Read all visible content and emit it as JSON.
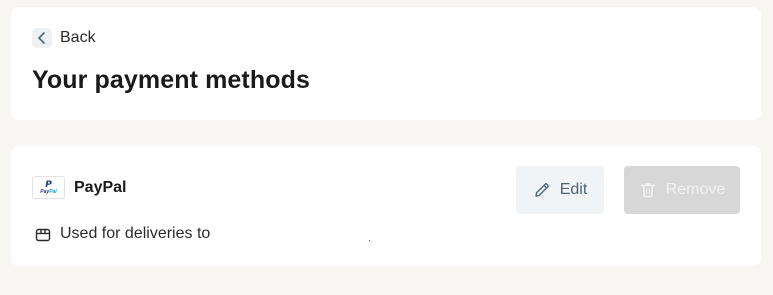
{
  "header": {
    "back_label": "Back",
    "title": "Your payment methods"
  },
  "payment_method": {
    "name": "PayPal",
    "logo_text": "PayPal",
    "usage_text": "Used for deliveries to",
    "edit_label": "Edit",
    "remove_label": "Remove",
    "remove_enabled": false
  },
  "icons": {
    "back": "chevron-left-icon",
    "logo": "paypal-logo",
    "usage": "box-icon",
    "edit": "pencil-icon",
    "remove": "trash-icon"
  },
  "colors": {
    "page_background": "#f7f6f3",
    "card_background": "#ffffff",
    "edit_button_background": "#f1f4f6",
    "edit_button_text": "#4d6573",
    "remove_button_background": "#d7d7d7",
    "paypal_dark_blue": "#253b80",
    "paypal_light_blue": "#179bd7"
  }
}
